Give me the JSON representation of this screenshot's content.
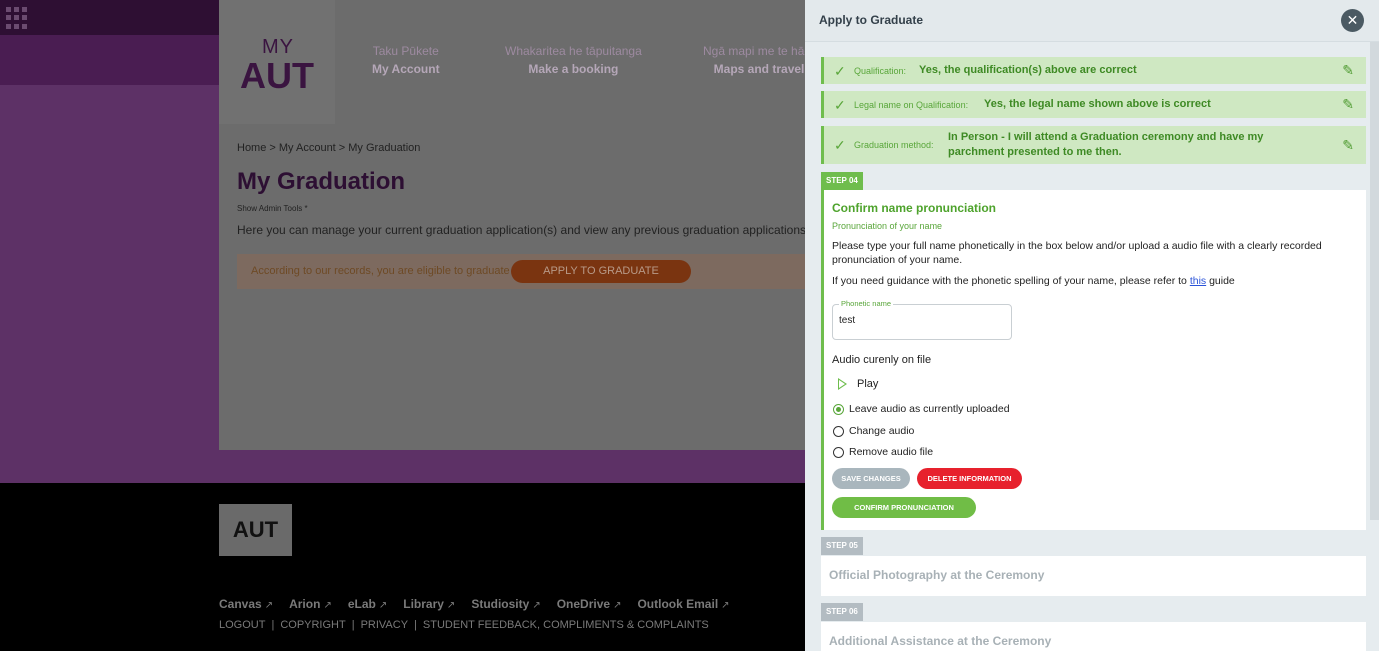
{
  "background": {
    "logo": {
      "my": "MY",
      "aut": "AUT"
    },
    "nav": [
      {
        "sub": "Taku Pūkete",
        "main": "My Account"
      },
      {
        "sub": "Whakaritea he tāpuitanga",
        "main": "Make a booking"
      },
      {
        "sub": "Ngā mapi me te hāer",
        "main": "Maps and travel"
      }
    ],
    "breadcrumb": "Home  >  My Account  >  My Graduation",
    "page_title": "My Graduation",
    "admin_tools": "Show Admin Tools *",
    "intro": "Here you can manage your current graduation application(s) and view any previous graduation applications.",
    "eligible_text": "According to our records, you are eligible to graduate",
    "apply_button": "APPLY TO GRADUATE",
    "footer": {
      "logo": "AUT",
      "links": [
        "Canvas",
        "Arion",
        "eLab",
        "Library",
        "Studiosity",
        "OneDrive",
        "Outlook Email"
      ],
      "external_glyph": "↗",
      "legal": [
        "LOGOUT",
        "COPYRIGHT",
        "PRIVACY",
        "STUDENT FEEDBACK, COMPLIMENTS & COMPLAINTS"
      ],
      "separator": "|"
    }
  },
  "panel": {
    "title": "Apply to Graduate",
    "close_glyph": "✕",
    "completed_steps": [
      {
        "label": "Qualification:",
        "value": "Yes, the qualification(s) above are correct"
      },
      {
        "label": "Legal name on Qualification:",
        "value": "Yes, the legal name shown above is correct"
      },
      {
        "label": "Graduation method:",
        "value": "In Person - I will attend a Graduation ceremony and have my parchment presented to me then."
      }
    ],
    "check_glyph": "✓",
    "edit_glyph": "✎",
    "active_step": {
      "tag": "STEP 04",
      "title": "Confirm name pronunciation",
      "subtitle": "Pronunciation of your name",
      "instructions": "Please type your full name phonetically in the box below and/or upload a audio file with a clearly recorded pronunciation of your name.",
      "guide_prefix": "If you need guidance with the phonetic spelling of your name, please refer to ",
      "guide_link": "this",
      "guide_suffix": " guide",
      "phonetic_label": "Phonetic name",
      "phonetic_value": "test",
      "audio_label": "Audio curenly on file",
      "play_label": "Play",
      "options": [
        {
          "label": "Leave audio as currently uploaded",
          "checked": true
        },
        {
          "label": "Change audio",
          "checked": false
        },
        {
          "label": "Remove audio file",
          "checked": false
        }
      ],
      "save_button": "SAVE CHANGES",
      "delete_button": "DELETE INFORMATION",
      "confirm_button": "CONFIRM PRONUNCIATION"
    },
    "upcoming_steps": [
      {
        "tag": "STEP 05",
        "title": "Official Photography at the Ceremony"
      },
      {
        "tag": "STEP 06",
        "title": "Additional Assistance at the Ceremony"
      }
    ]
  }
}
